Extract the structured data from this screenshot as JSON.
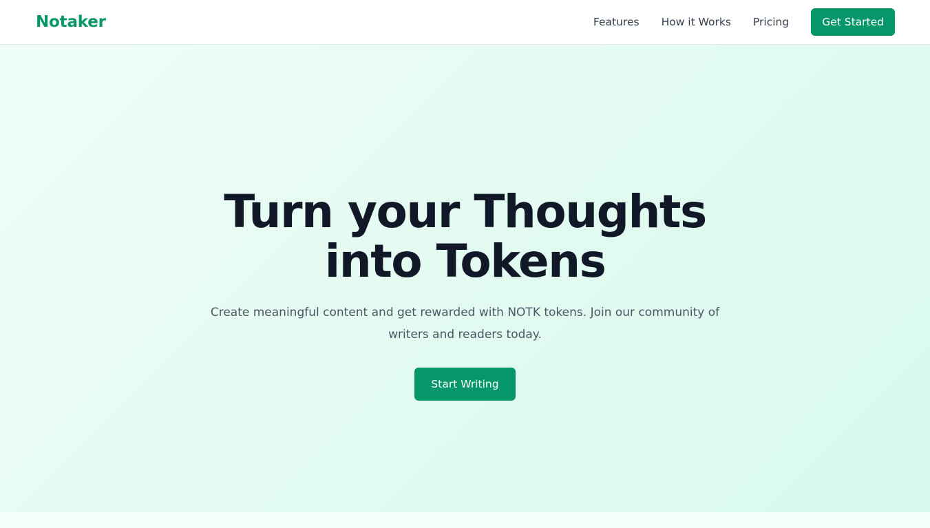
{
  "header": {
    "brand": "Notaker",
    "nav": [
      {
        "label": "Features"
      },
      {
        "label": "How it Works"
      },
      {
        "label": "Pricing"
      }
    ],
    "cta_label": "Get Started"
  },
  "hero": {
    "title": "Turn your Thoughts into Tokens",
    "subtitle": "Create meaningful content and get rewarded with NOTK tokens. Join our community of writers and readers today.",
    "cta_label": "Start Writing"
  },
  "colors": {
    "brand": "#059669",
    "heading": "#111827",
    "body_text": "#4b5563",
    "hero_bg_start": "#effdf7",
    "hero_bg_end": "#d8f9ef"
  }
}
